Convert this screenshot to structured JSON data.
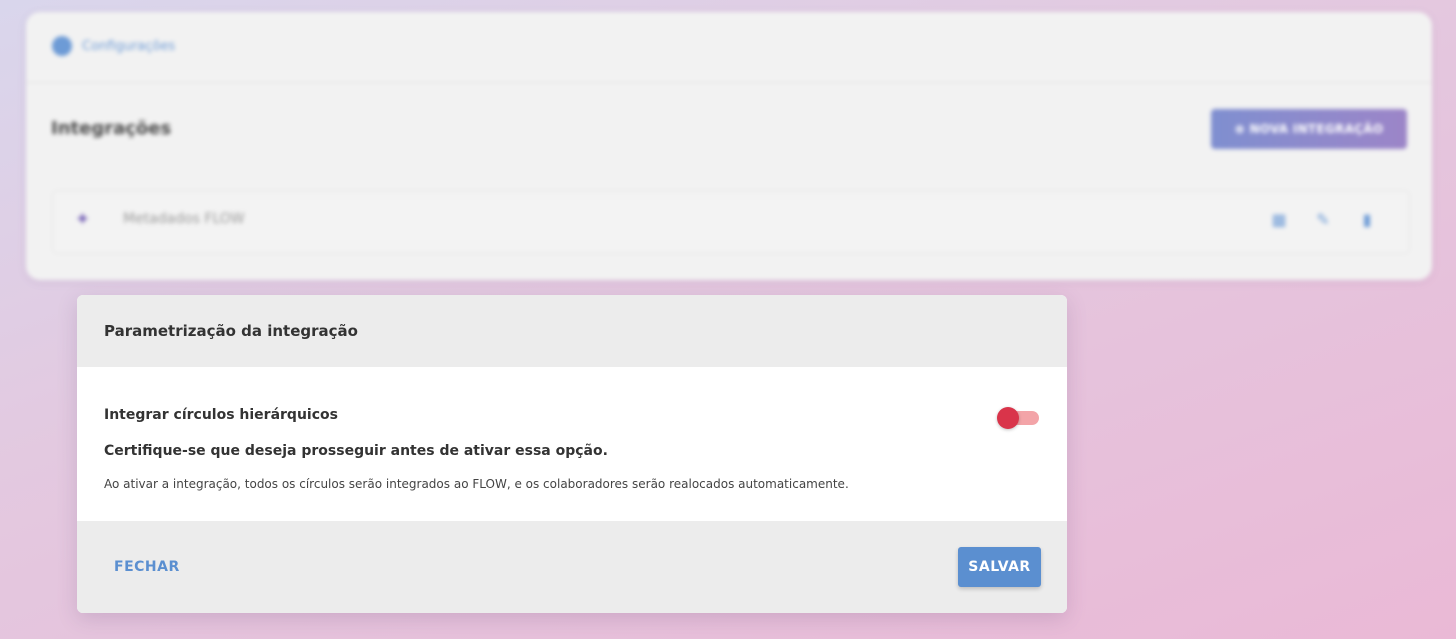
{
  "background": {
    "breadcrumb": "Configurações",
    "section_title": "Integrações",
    "new_integration_label": "⊕ NOVA INTEGRAÇÃO",
    "integration_row": {
      "name": "Metadados FLOW"
    }
  },
  "modal": {
    "title": "Parametrização da integração",
    "option_label": "Integrar círculos hierárquicos",
    "option_enabled": false,
    "warning": "Certifique-se que deseja prosseguir antes de ativar essa opção.",
    "description": "Ao ativar a integração, todos os círculos serão integrados ao FLOW, e os colaboradores serão realocados automaticamente.",
    "close_label": "FECHAR",
    "save_label": "SALVAR"
  },
  "colors": {
    "primary": "#5b8fd0",
    "toggle_knob": "#d9344a",
    "toggle_track": "#f3a4a8"
  }
}
